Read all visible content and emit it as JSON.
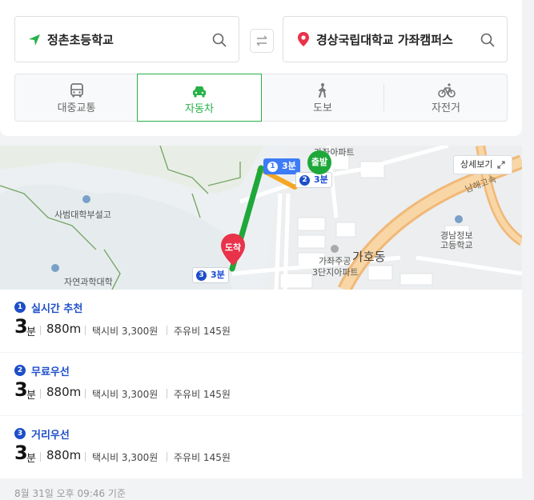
{
  "origin": {
    "label": "정촌초등학교"
  },
  "destination": {
    "label": "경상국립대학교 가좌캠퍼스"
  },
  "modes": [
    {
      "label": "대중교통",
      "icon": "bus-icon",
      "active": false
    },
    {
      "label": "자동차",
      "icon": "car-icon",
      "active": true
    },
    {
      "label": "도보",
      "icon": "walk-icon",
      "active": false
    },
    {
      "label": "자전거",
      "icon": "bike-icon",
      "active": false
    }
  ],
  "map": {
    "detail_button": "상세보기",
    "start_label": "출발",
    "end_label": "도착",
    "place_labels": {
      "school1": "사범대학부설고",
      "school2": "자연과학대학",
      "school3_line1": "경남정보",
      "school3_line2": "고등학교",
      "district": "가호동",
      "apt_line1": "가좌주공",
      "apt_line2": "3단지아파트",
      "apt_top": "가좌아파트",
      "road": "남해고속"
    },
    "badges": [
      {
        "num": "1",
        "text": "3분"
      },
      {
        "num": "2",
        "text": "3분"
      },
      {
        "num": "3",
        "text": "3분"
      }
    ]
  },
  "routes": [
    {
      "num": "1",
      "name": "실시간 추천",
      "time": "3",
      "time_unit": "분",
      "distance": "880m",
      "taxi": "택시비 3,300원",
      "fuel": "주유비 145원"
    },
    {
      "num": "2",
      "name": "무료우선",
      "time": "3",
      "time_unit": "분",
      "distance": "880m",
      "taxi": "택시비 3,300원",
      "fuel": "주유비 145원"
    },
    {
      "num": "3",
      "name": "거리우선",
      "time": "3",
      "time_unit": "분",
      "distance": "880m",
      "taxi": "택시비 3,300원",
      "fuel": "주유비 145원"
    }
  ],
  "footer": {
    "timestamp": "8월 31일 오후 09:46 기준"
  },
  "colors": {
    "accent": "#27b148",
    "route_blue": "#1d4ec9",
    "route_green": "#1fa83a",
    "route_orange": "#f5a623",
    "end_pin": "#e8334a"
  }
}
